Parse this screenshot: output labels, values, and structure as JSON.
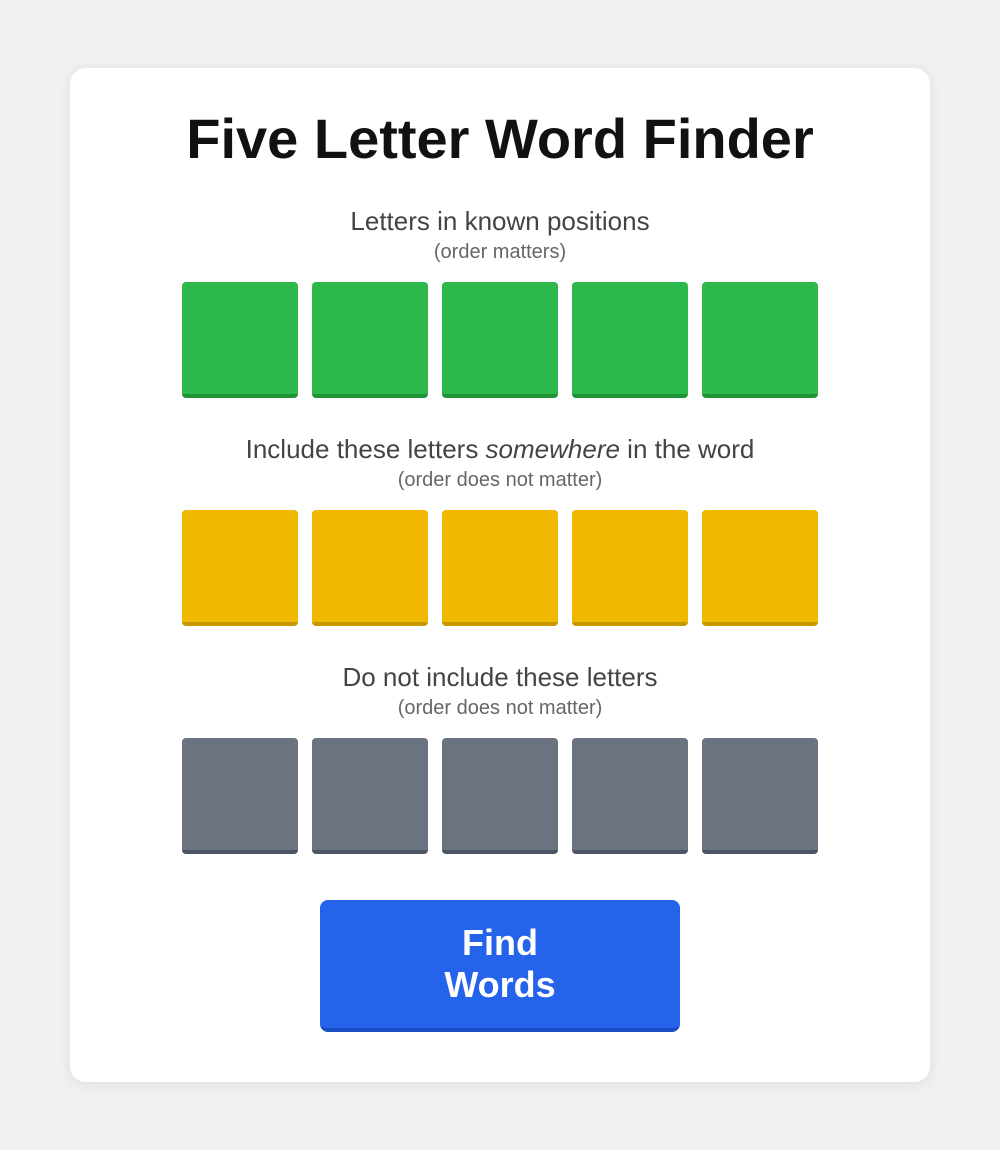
{
  "page": {
    "title": "Five Letter Word Finder",
    "card": {
      "section_known": {
        "title": "Letters in known positions",
        "subtitle": "(order matters)",
        "tiles": [
          {
            "value": "",
            "color": "green"
          },
          {
            "value": "",
            "color": "green"
          },
          {
            "value": "",
            "color": "green"
          },
          {
            "value": "",
            "color": "green"
          },
          {
            "value": "",
            "color": "green"
          }
        ]
      },
      "section_somewhere": {
        "title_prefix": "Include these letters ",
        "title_italic": "somewhere",
        "title_suffix": " in the word",
        "subtitle": "(order does not matter)",
        "tiles": [
          {
            "value": "",
            "color": "yellow"
          },
          {
            "value": "",
            "color": "yellow"
          },
          {
            "value": "",
            "color": "yellow"
          },
          {
            "value": "",
            "color": "yellow"
          },
          {
            "value": "",
            "color": "yellow"
          }
        ]
      },
      "section_exclude": {
        "title": "Do not include these letters",
        "subtitle": "(order does not matter)",
        "tiles": [
          {
            "value": "",
            "color": "gray"
          },
          {
            "value": "",
            "color": "gray"
          },
          {
            "value": "",
            "color": "gray"
          },
          {
            "value": "",
            "color": "gray"
          },
          {
            "value": "",
            "color": "gray"
          }
        ]
      },
      "find_button_label": "Find Words"
    }
  }
}
